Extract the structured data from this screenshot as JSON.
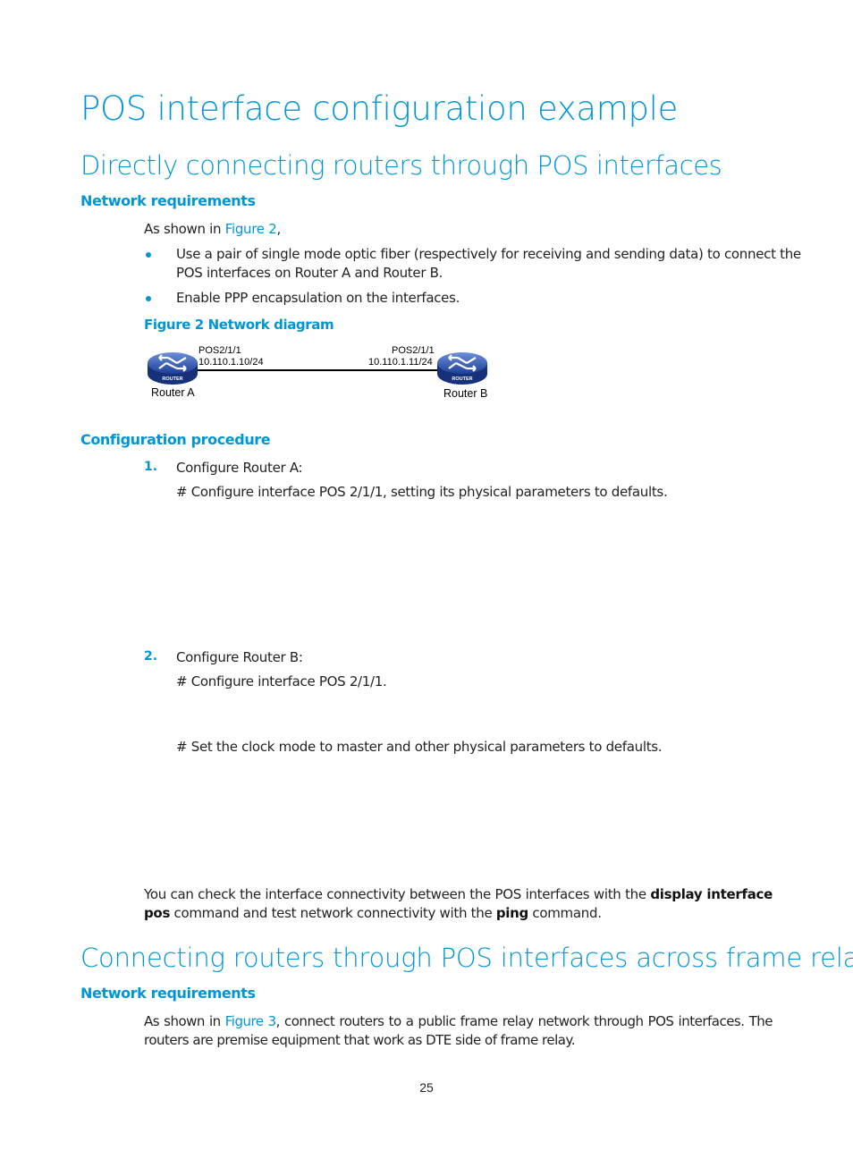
{
  "title": "POS interface configuration example",
  "section1": {
    "heading": "Directly connecting routers through POS interfaces",
    "network_requirements": {
      "heading": "Network requirements",
      "intro_prefix": "As shown in ",
      "intro_link": "Figure 2",
      "intro_suffix": ",",
      "bullets": [
        {
          "line1": "Use a pair of single mode optic fiber (respectively for receiving and sending data) to connect the",
          "line2": "POS interfaces on Router A and Router B."
        },
        {
          "line1": "Enable PPP encapsulation on the interfaces."
        }
      ],
      "figure_caption": "Figure 2 Network diagram",
      "diagram": {
        "router_a": {
          "name": "Router A",
          "interface": "POS2/1/1",
          "ip": "10.110.1.10/24",
          "badge": "ROUTER"
        },
        "router_b": {
          "name": "Router B",
          "interface": "POS2/1/1",
          "ip": "10.110.1.11/24",
          "badge": "ROUTER"
        }
      }
    },
    "configuration_procedure": {
      "heading": "Configuration procedure",
      "steps": [
        {
          "number": "1.",
          "title": "Configure Router A:",
          "notes": [
            "# Configure interface POS 2/1/1, setting its physical parameters to defaults."
          ]
        },
        {
          "number": "2.",
          "title": "Configure Router B:",
          "notes": [
            "# Configure interface POS 2/1/1.",
            "# Set the clock mode to master and other physical parameters to defaults."
          ]
        }
      ],
      "verify": {
        "text1": "You can check the interface connectivity between the POS interfaces with the ",
        "cmd1": "display interface pos",
        "text2": " command and test network connectivity with the ",
        "cmd2": "ping",
        "text3": " command."
      }
    }
  },
  "section2": {
    "heading": "Connecting routers through POS interfaces across frame relay",
    "network_requirements": {
      "heading": "Network requirements",
      "intro_prefix": "As shown in ",
      "intro_link": "Figure 3",
      "intro_suffix": ", connect routers to a public frame relay network through POS interfaces. The routers are premise equipment that work as DTE side of frame relay."
    }
  },
  "page_number": "25",
  "colors": {
    "accent": "#0096d6",
    "text": "#222222"
  }
}
